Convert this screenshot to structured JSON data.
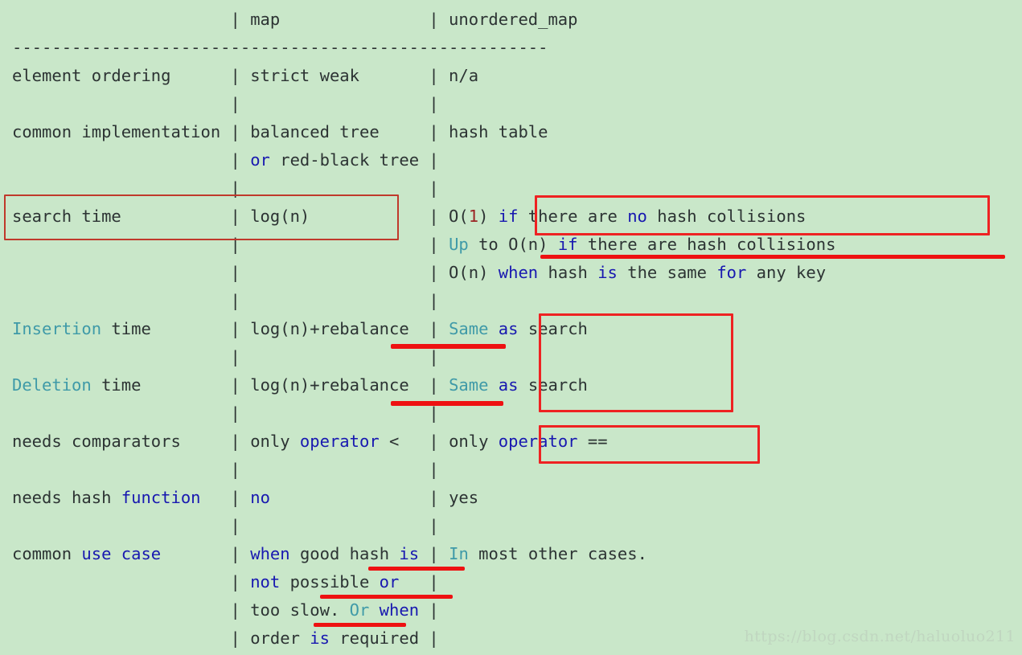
{
  "background_color": "#c9e7c9",
  "text_color": "#2c3333",
  "keyword_color": "#1818b0",
  "teal_color": "#3f9aa8",
  "number_color": "#9b2424",
  "annotation_color": "#ee1111",
  "watermark": "https://blog.csdn.net/haluoluo211",
  "table": {
    "columns": [
      "",
      "map",
      "unordered_map"
    ],
    "separator": "------------------------------------------------------",
    "rows": [
      {
        "label": "element ordering",
        "map": [
          "strict weak"
        ],
        "unordered_map": [
          "n/a"
        ]
      },
      {
        "label": "common implementation",
        "map": [
          "balanced tree",
          "or red-black tree"
        ],
        "unordered_map": [
          "hash table"
        ]
      },
      {
        "label": "search time",
        "map": [
          "log(n)"
        ],
        "unordered_map": [
          "O(1) if there are no hash collisions",
          "Up to O(n) if there are hash collisions",
          "O(n) when hash is the same for any key"
        ]
      },
      {
        "label": "Insertion time",
        "map": [
          "log(n)+rebalance"
        ],
        "unordered_map": [
          "Same as search"
        ]
      },
      {
        "label": "Deletion time",
        "map": [
          "log(n)+rebalance"
        ],
        "unordered_map": [
          "Same as search"
        ]
      },
      {
        "label": "needs comparators",
        "map": [
          "only operator <"
        ],
        "unordered_map": [
          "only operator =="
        ]
      },
      {
        "label": "needs hash function",
        "map": [
          "no"
        ],
        "unordered_map": [
          "yes"
        ]
      },
      {
        "label": "common use case",
        "map": [
          "when good hash is",
          "not possible or",
          "too slow. Or when",
          "order is required"
        ],
        "unordered_map": [
          "In most other cases."
        ]
      }
    ]
  },
  "annotations": {
    "boxes": [
      {
        "name": "search-time-map-box",
        "label": "search time | log(n)"
      },
      {
        "name": "o1-no-collisions-box",
        "label": "O(1) if there are no hash collisions"
      },
      {
        "name": "same-as-search-box",
        "label": "Same as search (Insertion & Deletion)"
      },
      {
        "name": "only-operator-eq-box",
        "label": "only operator =="
      }
    ],
    "underlines": [
      {
        "name": "up-to-on-underline",
        "label": "Up to O(n) if there are hash collisions"
      },
      {
        "name": "insertion-rebalance-underline",
        "label": "rebalance"
      },
      {
        "name": "deletion-rebalance-underline",
        "label": "rebalance"
      },
      {
        "name": "good-hash-underline",
        "label": "good hash is"
      },
      {
        "name": "not-possible-underline",
        "label": "not possible"
      },
      {
        "name": "too-slow-underline",
        "label": "too slow."
      }
    ]
  },
  "code_lines": [
    "                      | map               | unordered_map",
    "------------------------------------------------------",
    "element ordering      | strict weak       | n/a",
    "                      |                   |",
    "common implementation | balanced tree     | hash table",
    "                      | or red-black tree |",
    "                      |                   |",
    "search time           | log(n)            | O(1) if there are no hash collisions",
    "                      |                   | Up to O(n) if there are hash collisions",
    "                      |                   | O(n) when hash is the same for any key",
    "                      |                   |",
    "Insertion time        | log(n)+rebalance  | Same as search",
    "                      |                   |",
    "Deletion time         | log(n)+rebalance  | Same as search",
    "                      |                   |",
    "needs comparators     | only operator <   | only operator ==",
    "                      |                   |",
    "needs hash function   | no                | yes",
    "                      |                   |",
    "common use case       | when good hash is | In most other cases.",
    "                      | not possible or   |",
    "                      | too slow. Or when |",
    "                      | order is required |"
  ]
}
